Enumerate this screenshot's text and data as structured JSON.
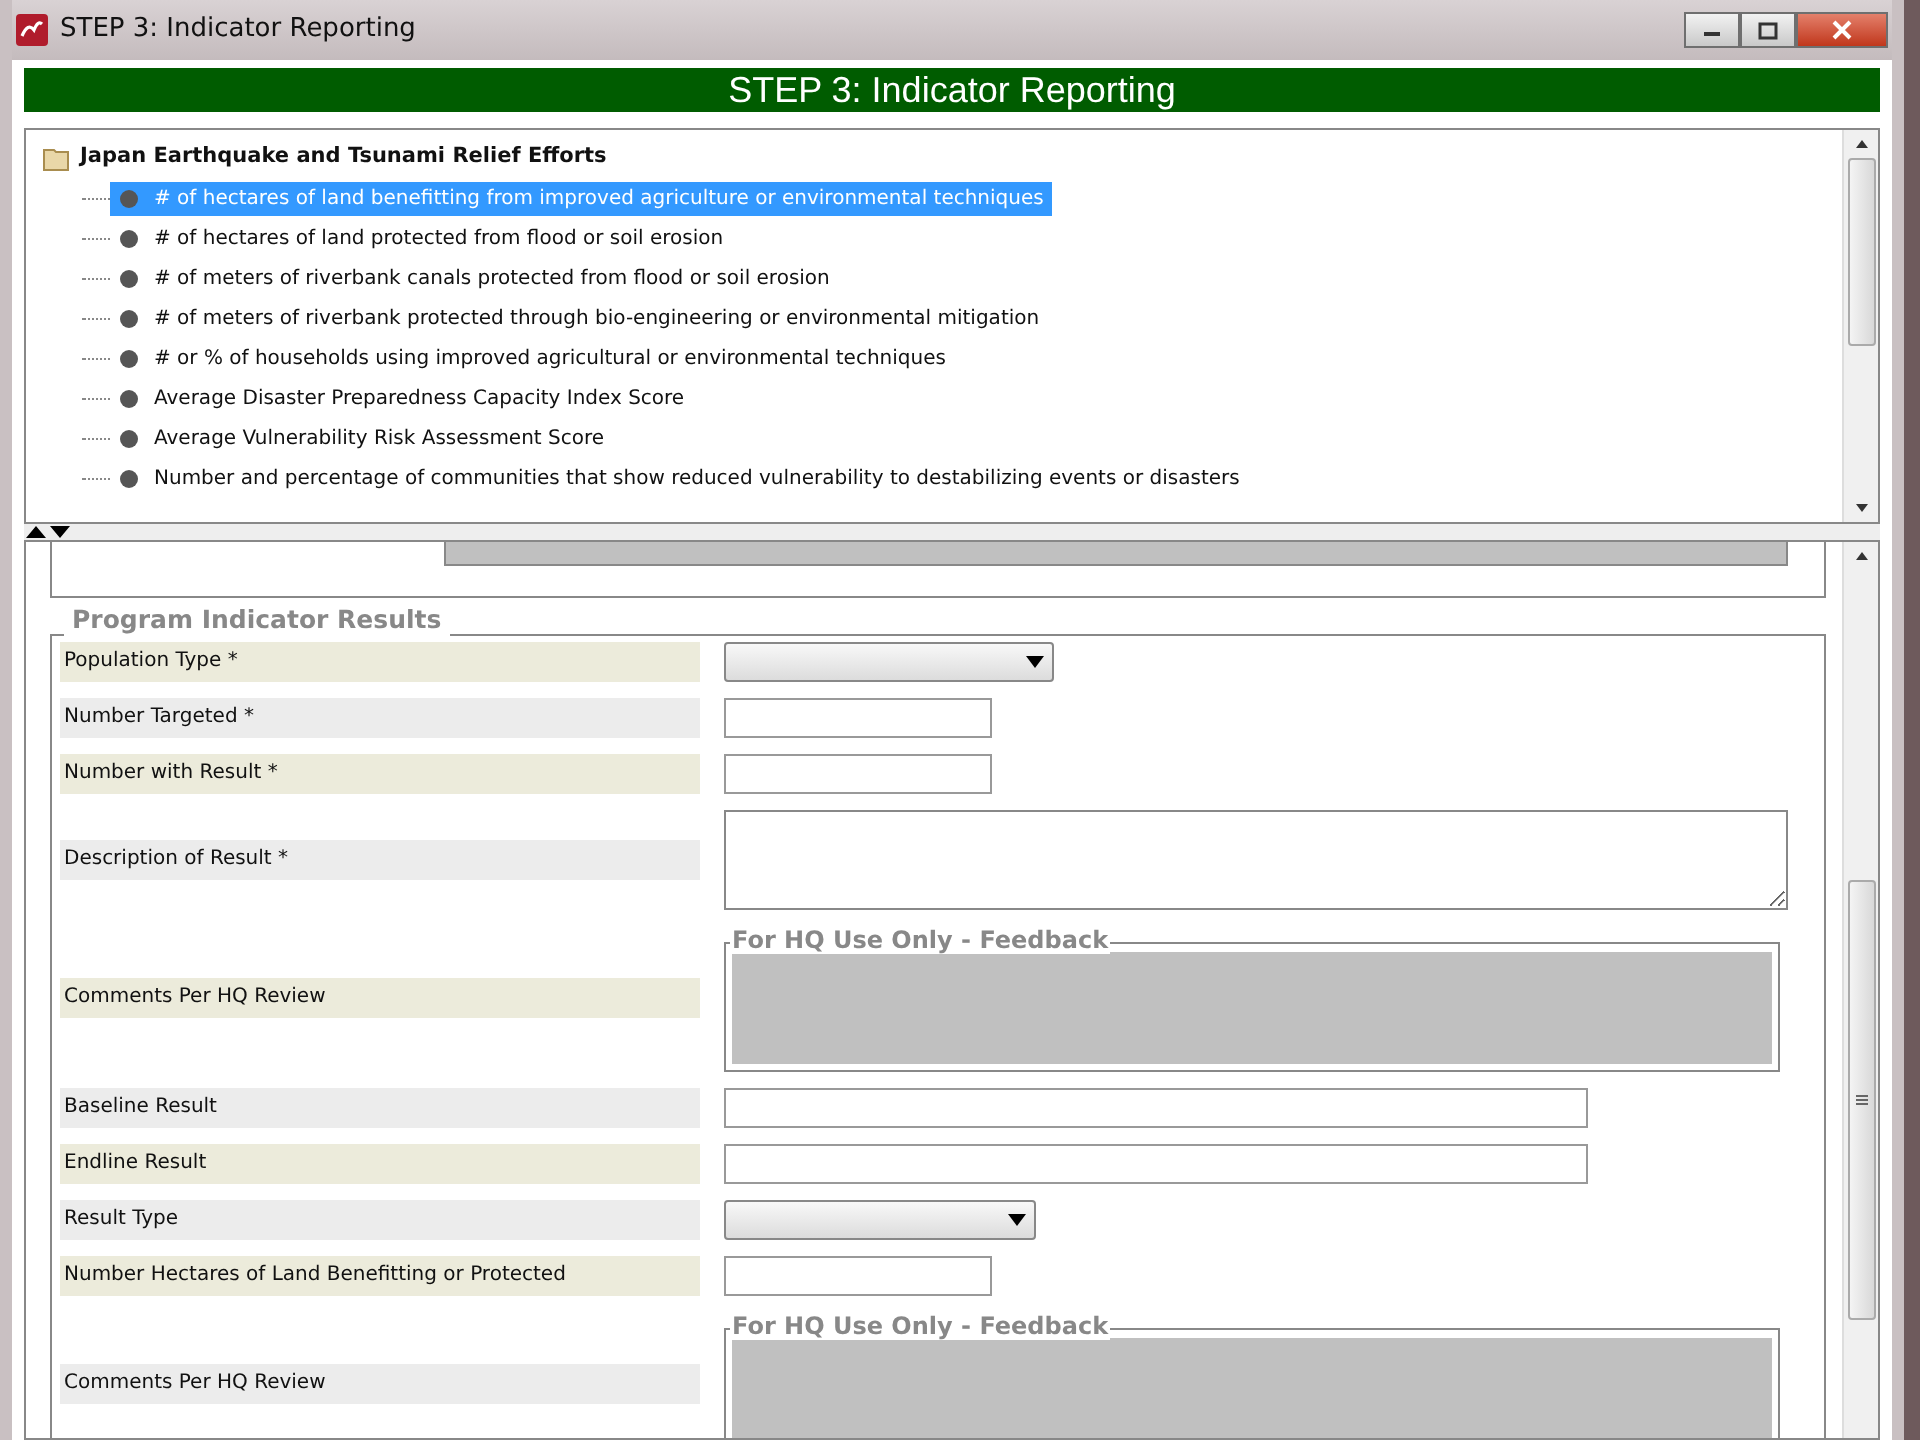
{
  "window": {
    "title": "STEP 3: Indicator Reporting"
  },
  "header": {
    "title": "STEP 3: Indicator Reporting"
  },
  "tree": {
    "root": {
      "label": "Japan Earthquake and Tsunami Relief Efforts",
      "children": [
        {
          "label": "# of hectares of land benefitting from improved agriculture or environmental techniques",
          "selected": true
        },
        {
          "label": "# of hectares of land protected from flood or soil erosion",
          "selected": false
        },
        {
          "label": "# of meters of riverbank canals protected from flood or soil erosion",
          "selected": false
        },
        {
          "label": "# of meters of riverbank protected through bio-engineering or environmental mitigation",
          "selected": false
        },
        {
          "label": "# or % of households using improved agricultural or environmental techniques",
          "selected": false
        },
        {
          "label": "Average Disaster Preparedness Capacity Index Score",
          "selected": false
        },
        {
          "label": "Average Vulnerability Risk Assessment Score",
          "selected": false
        },
        {
          "label": "Number and percentage of communities that show reduced vulnerability to destabilizing events or disasters",
          "selected": false
        }
      ]
    }
  },
  "form": {
    "legend": "Program Indicator Results",
    "rows": [
      {
        "label": "Population Type *",
        "kind": "select"
      },
      {
        "label": "Number Targeted *",
        "kind": "short"
      },
      {
        "label": "Number with Result *",
        "kind": "short"
      },
      {
        "label": "Description of Result *",
        "kind": "textarea"
      },
      {
        "label": "Comments Per HQ Review",
        "kind": "feedback",
        "legend": "For HQ Use Only - Feedback"
      },
      {
        "label": "Baseline Result",
        "kind": "long"
      },
      {
        "label": "Endline Result",
        "kind": "long"
      },
      {
        "label": "Result Type",
        "kind": "select"
      },
      {
        "label": "Number Hectares of Land Benefitting or Protected",
        "kind": "short"
      },
      {
        "label": "Comments Per HQ Review",
        "kind": "feedback",
        "legend": "For HQ Use Only - Feedback"
      }
    ]
  }
}
